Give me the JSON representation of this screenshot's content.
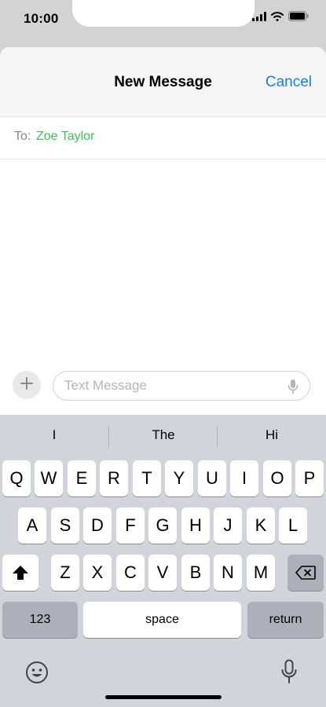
{
  "status_bar": {
    "time": "10:00"
  },
  "nav": {
    "title": "New Message",
    "cancel_label": "Cancel"
  },
  "recipient": {
    "to_label": "To:",
    "name": "Zoe Taylor"
  },
  "compose": {
    "placeholder": "Text Message",
    "value": ""
  },
  "suggestions": [
    "I",
    "The",
    "Hi"
  ],
  "keyboard": {
    "row1": [
      "Q",
      "W",
      "E",
      "R",
      "T",
      "Y",
      "U",
      "I",
      "O",
      "P"
    ],
    "row2": [
      "A",
      "S",
      "D",
      "F",
      "G",
      "H",
      "J",
      "K",
      "L"
    ],
    "row3": [
      "Z",
      "X",
      "C",
      "V",
      "B",
      "N",
      "M"
    ],
    "numbers_label": "123",
    "space_label": "space",
    "return_label": "return"
  },
  "icons": {
    "signal": "cellular-signal-icon",
    "wifi": "wifi-icon",
    "battery": "battery-icon",
    "plus": "plus-icon",
    "mic": "microphone-icon",
    "shift": "shift-icon",
    "delete": "backspace-icon",
    "emoji": "emoji-icon"
  },
  "colors": {
    "accent": "#1a7fd9",
    "recipient": "#34c759",
    "keyboard_bg": "#d1d4da",
    "key_dark": "#abb0bb"
  }
}
